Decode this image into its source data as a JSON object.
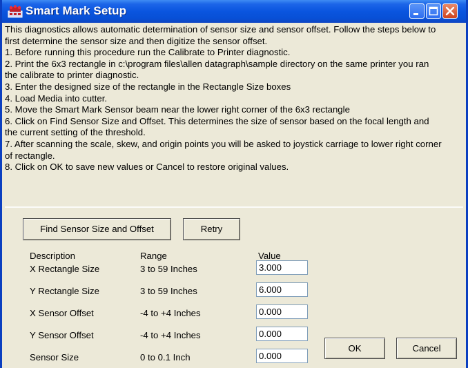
{
  "window": {
    "title": "Smart Mark Setup"
  },
  "info": {
    "lines": [
      "This diagnostics allows automatic determination of sensor size and sensor offset.  Follow the steps below to",
      "first determine the sensor size and then digitize the sensor offset.",
      "1. Before running this procedure run the Calibrate to Printer diagnostic.",
      "2. Print the 6x3 rectangle in c:\\program files\\allen datagraph\\sample directory on the same printer you ran",
      "the calibrate to printer diagnostic.",
      "3. Enter the designed size of the rectangle in the Rectangle Size boxes",
      "4. Load Media into cutter.",
      "5. Move the Smart Mark Sensor beam near the lower right corner of the 6x3 rectangle",
      "6. Click on Find Sensor Size and Offset.  This determines the size of sensor based on the focal length and",
      "the current setting of the threshold.",
      "7. After scanning the scale, skew, and origin points you will be asked to joystick carriage to lower right corner",
      "of rectangle.",
      "8. Click on OK to save new values or Cancel to restore original values."
    ]
  },
  "buttons": {
    "find": "Find Sensor Size and Offset",
    "retry": "Retry",
    "ok": "OK",
    "cancel": "Cancel"
  },
  "table": {
    "headers": {
      "description": "Description",
      "range": "Range",
      "value": "Value"
    },
    "rows": [
      {
        "description": "X Rectangle Size",
        "range": "3 to 59 Inches",
        "value": "3.000"
      },
      {
        "description": "Y Rectangle Size",
        "range": "3 to 59 Inches",
        "value": "6.000"
      },
      {
        "description": "X Sensor Offset",
        "range": "-4 to +4 Inches",
        "value": "0.000"
      },
      {
        "description": "Y Sensor Offset",
        "range": "-4 to +4 Inches",
        "value": "0.000"
      },
      {
        "description": "Sensor Size",
        "range": "0 to 0.1 Inch",
        "value": "0.000"
      }
    ]
  },
  "colors": {
    "title_bar": "#0a55df",
    "dialog_background": "#ece9d8",
    "close_button": "#d0451f"
  }
}
